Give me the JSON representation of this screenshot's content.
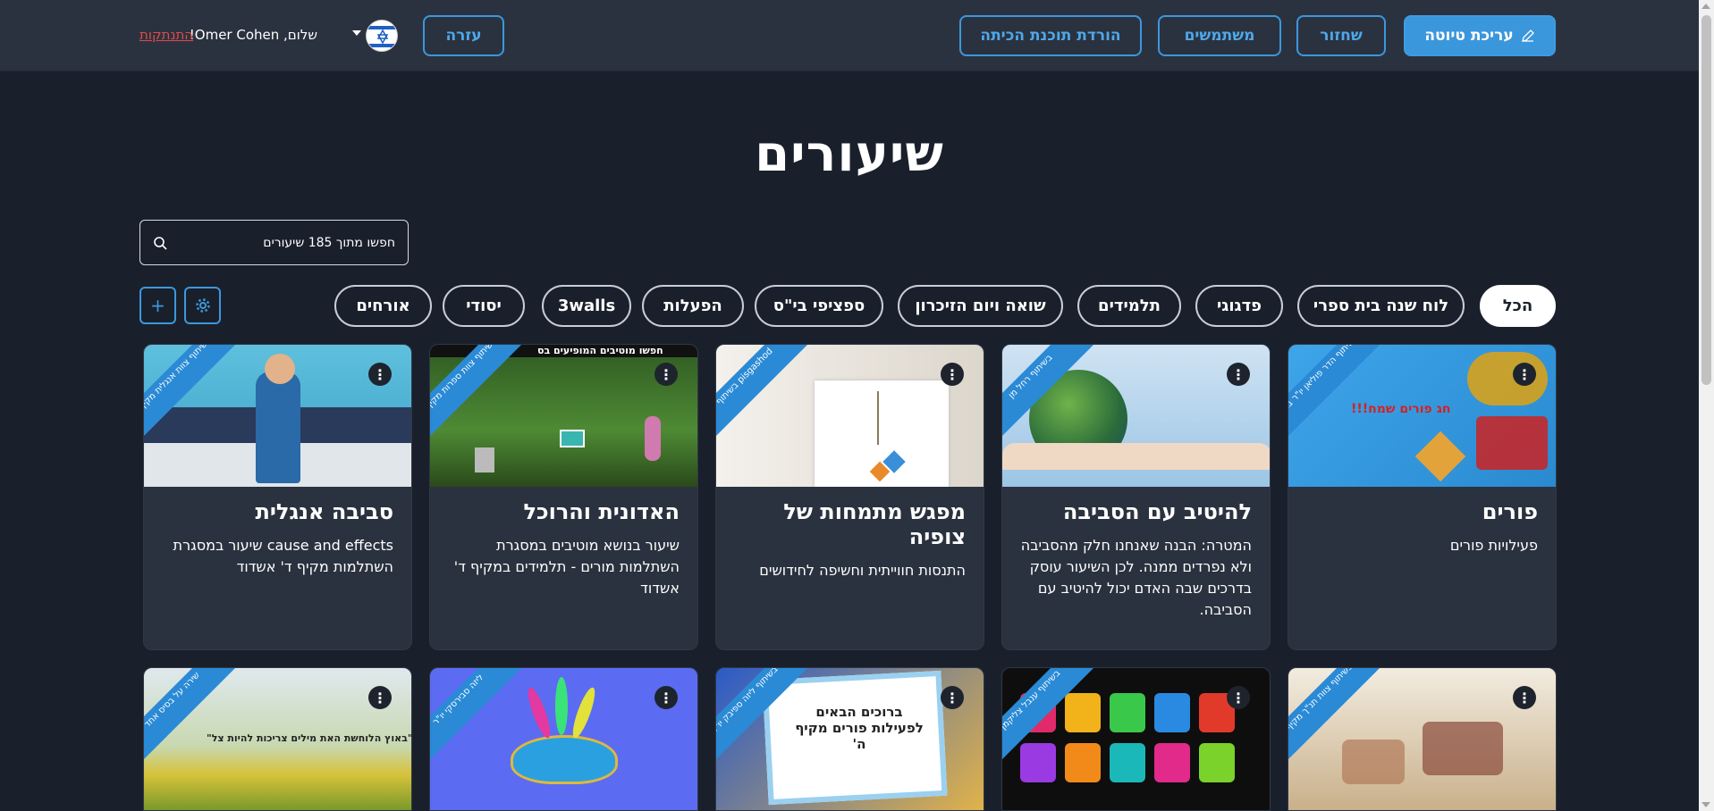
{
  "header": {
    "edit_draft_label": "עריכת טיוטה",
    "restore_label": "שחזור",
    "users_label": "משתמשים",
    "download_label": "הורדת תוכנת הכיתה",
    "help_label": "עזרה",
    "greeting": "שלום, Omer Cohen!",
    "logout_label": "התנתקות"
  },
  "page": {
    "title": "שיעורים"
  },
  "search": {
    "placeholder": "חפשו מתוך 185 שיעורים"
  },
  "categories": [
    "הכל",
    "לוח שנה בית ספרי",
    "פדגוגי",
    "תלמידים",
    "שואה ויום הזיכרון",
    "ספציפי בי\"ס",
    "הפעלות",
    "3walls",
    "יסודי",
    "אורחים"
  ],
  "actions": {
    "add_icon": "plus-icon",
    "settings_icon": "gear-icon"
  },
  "cards": [
    {
      "title": "פורים",
      "desc": "פעילויות פורים",
      "ribbon": "בשיתוף הדר פוליאן יו\"ר ברלב",
      "img_text": "חג פורים שמח!!!",
      "bg": "#3aa2e8"
    },
    {
      "title": "להיטיב עם הסביבה",
      "desc": "המטרה: הבנה שאנחנו חלק מהסביבה ולא נפרדים ממנה. לכן השיעור עוסק בדרכים שבה האדם יכול להיטיב עם הסביבה.",
      "ribbon": "בשיתוף רחל מן",
      "img_text": "",
      "bg": "#9fc8e4"
    },
    {
      "title": "מפגש מתמחות של צופיה",
      "desc": "התנסות חווייתית וחשיפה לחידושים",
      "ribbon": "בשיתוף pisgashod",
      "img_text": "",
      "bg": "#e9e4dc"
    },
    {
      "title": "האדונית והרוכל",
      "desc": "שיעור בנושא מוטיבים במסגרת השתלמות מורים - תלמידים במקיף ד' אשדוד",
      "ribbon": "בשיתוף צוות ספרות מקיף ד",
      "img_text": "חפשו מוטיבים המופיעים בס",
      "bg": "#3f6e2a"
    },
    {
      "title": "סביבה אנגלית",
      "desc": "cause and effects שיעור במסגרת השתלמות מקיף ד' אשדוד",
      "ribbon": "בשיתוף צוות אנגלית מקיף ד",
      "img_text": "",
      "bg": "#4aa7c7"
    },
    {
      "title": "",
      "desc": "",
      "ribbon": "בשיתוף צוות תנ\"ך מקיף ד",
      "img_text": "",
      "bg": "#d8c8a8"
    },
    {
      "title": "",
      "desc": "",
      "ribbon": "בשיתוף ענבל צליקמן",
      "img_text": "",
      "bg": "#111111"
    },
    {
      "title": "",
      "desc": "",
      "ribbon": "בשיתוף ליזה ספיבק יו\"ר",
      "img_text": "ברוכים הבאים לפעילות פורים מקיף ה'",
      "bg": "#e0b24a"
    },
    {
      "title": "",
      "desc": "",
      "ribbon": "ליזה סבירסקי יו\"ר",
      "img_text": "",
      "bg": "#5a6cf0"
    },
    {
      "title": "",
      "desc": "",
      "ribbon": "שירה על בסיס אחד",
      "img_text": "\"באוץ הלוחשת האת מילים צריכות להיות צל\"",
      "bg": "#8a9a3a"
    }
  ],
  "colors": {
    "accent": "#3b97dc",
    "background": "#1a202b",
    "card": "#2b323f",
    "logout": "#e04a4a"
  }
}
